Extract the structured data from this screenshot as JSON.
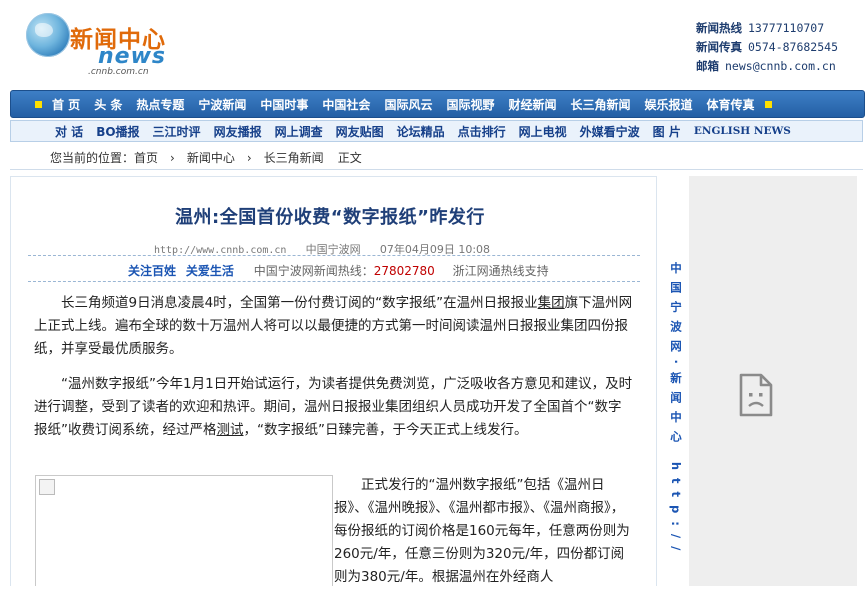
{
  "header": {
    "logo_title": "新闻中心",
    "logo_news": "news",
    "logo_domain": ".cnnb.com.cn",
    "hotline_label": "新闻热线",
    "hotline_value": "13777110707",
    "fax_label": "新闻传真",
    "fax_value": "0574-87682545",
    "email_label": "邮箱",
    "email_value": "news@cnnb.com.cn"
  },
  "nav_main": [
    "首 页",
    "头 条",
    "热点专题",
    "宁波新闻",
    "中国时事",
    "中国社会",
    "国际风云",
    "国际视野",
    "财经新闻",
    "长三角新闻",
    "娱乐报道",
    "体育传真"
  ],
  "nav_sub": [
    "对 话",
    "BO播报",
    "三江时评",
    "网友播报",
    "网上调查",
    "网友贴图",
    "论坛精品",
    "点击排行",
    "网上电视",
    "外媒看宁波",
    "图 片",
    "ENGLISH NEWS"
  ],
  "breadcrumb": {
    "prefix": "您当前的位置：",
    "items": [
      "首页",
      "新闻中心",
      "长三角新闻",
      "正文"
    ],
    "separator": "›"
  },
  "article": {
    "title": "温州:全国首份收费“数字报纸”昨发行",
    "url": "http://www.cnnb.com.cn",
    "source": "中国宁波网",
    "date": "07年04月09日 10:08",
    "link_1": "关注百姓",
    "link_2": "关爱生活",
    "hotline_text": "中国宁波网新闻热线：",
    "hotline_number": "27802780",
    "support_text": "浙江网通热线支持",
    "para1_a": "长三角频道9日消息凌晨4时，全国第一份付费订阅的“数字报纸”在温州日报报业",
    "para1_link": "集团",
    "para1_b": "旗下温州网上正式上线。遍布全球的数十万温州人将可以以最便捷的方式第一时间阅读温州日报报业集团四份报纸，并享受最优质服务。",
    "para2_a": "“温州数字报纸”今年1月1日开始试运行，为读者提供免费浏览，广泛吸收各方意见和建议，及时进行调整，受到了读者的欢迎和热评。期间，温州日报报业集团组织人员成功开发了全国首个“数字报纸”收费订阅系统，经过严格",
    "para2_link": "测试",
    "para2_b": "，“数字报纸”日臻完善，于今天正式上线发行。",
    "para3_a": "正式发行的“温州数字报纸”包括《温州日报》、《温州晚报》、《温州都市报》、《温州商报》，每份报纸的订阅",
    "para3_link": "价格",
    "para3_b": "是160元每年，任意两份则为260元/年，任意三份则为320元/年，四份都订阅则为380元/年。根据温州在外经商人"
  },
  "sidebar": {
    "vertical_title": "中国宁波网·新闻中心  http://"
  },
  "colors": {
    "nav_blue": "#2b68ad",
    "headline_blue": "#1f3f78",
    "accent_orange": "#e06a0a",
    "hotline_red": "#c00000"
  }
}
